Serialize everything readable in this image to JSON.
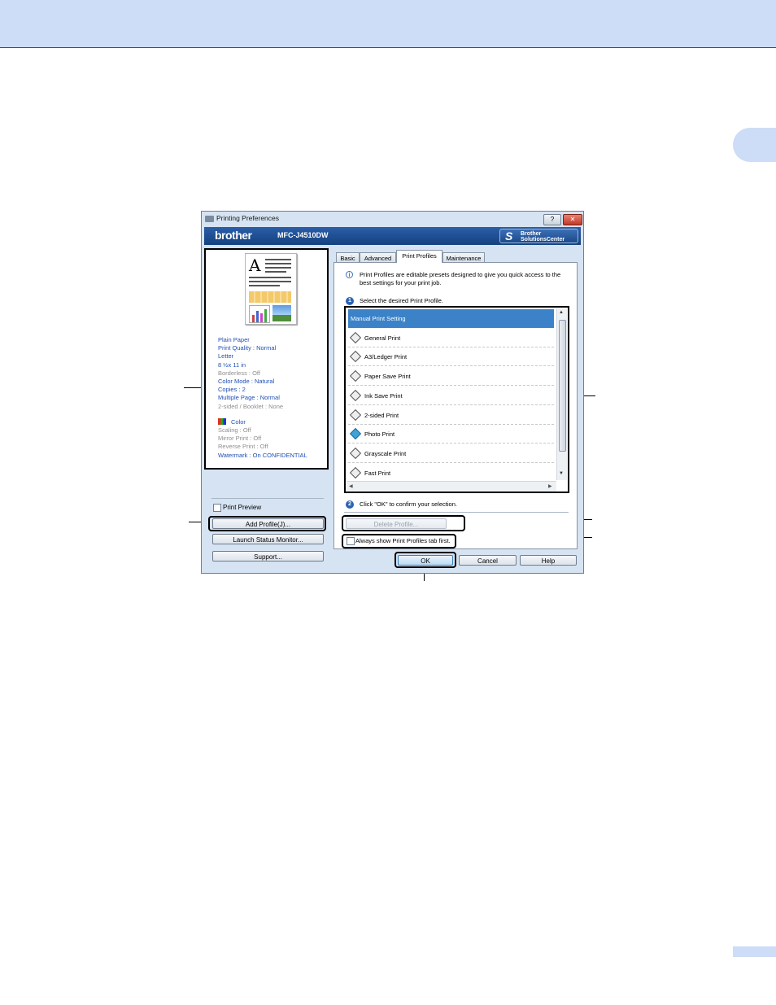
{
  "dialog": {
    "title": "Printing Preferences",
    "help_label": "?",
    "close_label": "✕",
    "brand": "brother",
    "model": "MFC-J4510DW",
    "solutions_line1": "Brother",
    "solutions_line2": "SolutionsCenter"
  },
  "left_panel": {
    "settings_group1": [
      {
        "text": "Plain Paper",
        "tone": "blue"
      },
      {
        "text": "Print Quality : Normal",
        "tone": "blue"
      },
      {
        "text": "Letter",
        "tone": "blue"
      },
      {
        "text": "8 ½x 11 in",
        "tone": "blue"
      },
      {
        "text": "Borderless : Off",
        "tone": "gray"
      },
      {
        "text": "Color Mode : Natural",
        "tone": "blue"
      },
      {
        "text": "Copies : 2",
        "tone": "blue"
      },
      {
        "text": "Multiple Page : Normal",
        "tone": "blue"
      },
      {
        "text": "2-sided / Booklet : None",
        "tone": "gray"
      }
    ],
    "color_label": "Color",
    "settings_group2": [
      {
        "text": "Scaling : Off",
        "tone": "gray"
      },
      {
        "text": "Mirror Print : Off",
        "tone": "gray"
      },
      {
        "text": "Reverse Print : Off",
        "tone": "gray"
      },
      {
        "text": "Watermark : On  CONFIDENTIAL",
        "tone": "blue"
      }
    ],
    "print_preview_label": "Print Preview",
    "add_profile_label": "Add Profile(J)...",
    "launch_status_label": "Launch Status Monitor...",
    "support_label": "Support..."
  },
  "tabs": [
    {
      "label": "Basic"
    },
    {
      "label": "Advanced"
    },
    {
      "label": "Print Profiles"
    },
    {
      "label": "Maintenance"
    }
  ],
  "profiles_tab": {
    "info_icon": "i",
    "info_text": "Print Profiles are editable presets designed to give you quick access to the best settings for your print job.",
    "step1_num": "1",
    "step1_text": "Select the desired Print Profile.",
    "profiles": [
      {
        "label": "Manual Print Setting",
        "selected": true,
        "icon": "none"
      },
      {
        "label": "General Print",
        "selected": false,
        "icon": "profile-icon"
      },
      {
        "label": "A3/Ledger Print",
        "selected": false,
        "icon": "profile-icon"
      },
      {
        "label": "Paper Save Print",
        "selected": false,
        "icon": "profile-icon"
      },
      {
        "label": "Ink Save Print",
        "selected": false,
        "icon": "profile-icon"
      },
      {
        "label": "2-sided Print",
        "selected": false,
        "icon": "profile-icon"
      },
      {
        "label": "Photo Print",
        "selected": false,
        "icon": "photo-icon"
      },
      {
        "label": "Grayscale Print",
        "selected": false,
        "icon": "profile-icon"
      },
      {
        "label": "Fast Print",
        "selected": false,
        "icon": "profile-icon"
      }
    ],
    "step2_num": "2",
    "step2_text": "Click \"OK\" to confirm your selection.",
    "delete_label": "Delete Profile...",
    "always_show_label": "Always show Print Profiles tab first."
  },
  "footer_buttons": {
    "ok": "OK",
    "cancel": "Cancel",
    "help": "Help"
  },
  "colors": {
    "page_band": "#cddcf7",
    "banner": "#1b4a8a",
    "selection": "#3b82c8",
    "settings_blue": "#1f4fb5"
  }
}
